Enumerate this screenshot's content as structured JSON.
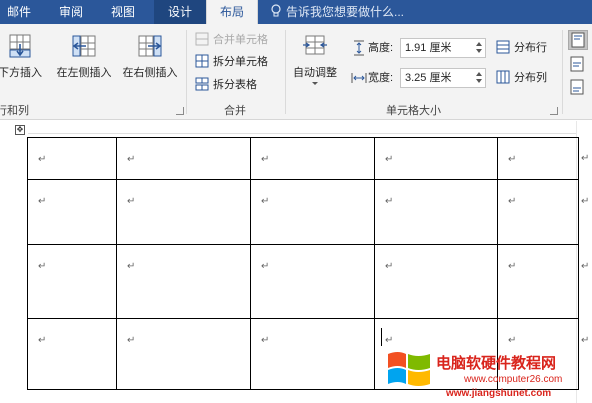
{
  "tabs": {
    "mail": "邮件",
    "review": "审阅",
    "view": "视图",
    "design": "设计",
    "layout": "布局"
  },
  "tell_me": {
    "placeholder": "告诉我您想要做什么..."
  },
  "ribbon": {
    "rows_cols": {
      "insert_below": "下方插入",
      "insert_left": "在左侧插入",
      "insert_right": "在右侧插入",
      "group_label": "行和列"
    },
    "merge": {
      "merge_cells": "合并单元格",
      "split_cells": "拆分单元格",
      "split_table": "拆分表格",
      "group_label": "合并"
    },
    "cell_size": {
      "autofit": "自动调整",
      "height_label": "高度:",
      "height_value": "1.91 厘米",
      "width_label": "宽度:",
      "width_value": "3.25 厘米",
      "distribute_rows": "分布行",
      "distribute_cols": "分布列",
      "group_label": "单元格大小"
    }
  },
  "document": {
    "move_handle": "✥",
    "rows": [
      [
        "↵",
        "↵",
        "↵",
        "↵",
        "↵"
      ],
      [
        "↵",
        "↵",
        "↵",
        "↵",
        "↵"
      ],
      [
        "↵",
        "↵",
        "↵",
        "↵",
        "↵"
      ],
      [
        "↵",
        "↵",
        "↵",
        "↵",
        "↵"
      ]
    ],
    "end_marks": [
      "↵",
      "↵",
      "↵",
      "↵"
    ]
  },
  "watermark": {
    "title": "电脑软硬件教程网",
    "url1": "www.computer26.com",
    "url2": "www.jiangshunet.com"
  }
}
